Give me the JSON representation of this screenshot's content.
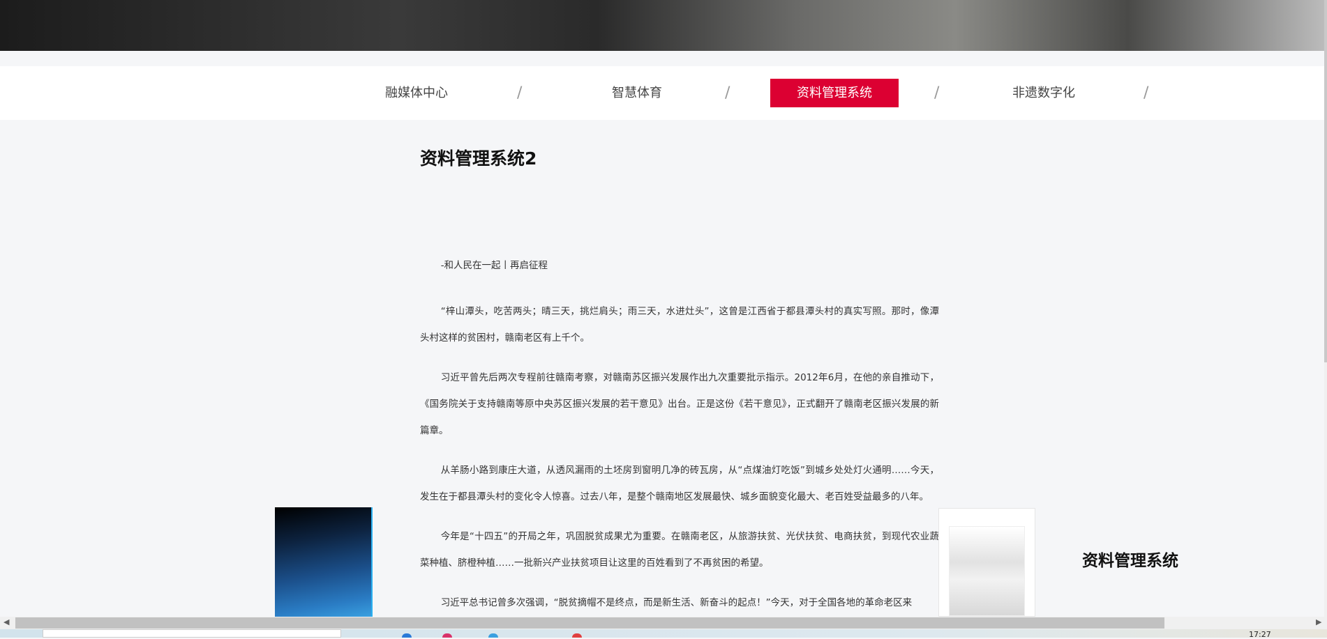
{
  "nav": {
    "items": [
      {
        "label": "融媒体中心",
        "active": false
      },
      {
        "label": "智慧体育",
        "active": false
      },
      {
        "label": "资料管理系统",
        "active": true
      },
      {
        "label": "非遗数字化",
        "active": false
      }
    ],
    "separator": "/"
  },
  "page_title": "资料管理系统2",
  "article": {
    "paragraphs": [
      "-和人民在一起丨再启征程",
      "“梓山潭头，吃苦两头；晴三天，挑烂肩头；雨三天，水进灶头”，这曾是江西省于都县潭头村的真实写照。那时，像潭头村这样的贫困村，赣南老区有上千个。",
      "习近平曾先后两次专程前往赣南考察，对赣南苏区振兴发展作出九次重要批示指示。2012年6月，在他的亲自推动下，《国务院关于支持赣南等原中央苏区振兴发展的若干意见》出台。正是这份《若干意见》，正式翻开了赣南老区振兴发展的新篇章。",
      "从羊肠小路到康庄大道，从透风漏雨的土坯房到窗明几净的砖瓦房，从“点煤油灯吃饭”到城乡处处灯火通明……今天，发生在于都县潭头村的变化令人惊喜。过去八年，是整个赣南地区发展最快、城乡面貌变化最大、老百姓受益最多的八年。",
      "今年是“十四五”的开局之年，巩固脱贫成果尤为重要。在赣南老区，从旅游扶贫、光伏扶贫、电商扶贫，到现代农业蔬菜种植、脐橙种植……一批新兴产业扶贫项目让这里的百姓看到了不再贫困的希望。",
      "习近平总书记曾多次强调，“脱贫摘帽不是终点，而是新生活、新奋斗的起点！”今天，对于全国各地的革命老区来"
    ]
  },
  "side_title": "资料管理系统",
  "taskbar": {
    "time": "17:27"
  },
  "colors": {
    "accent": "#dc0032",
    "background": "#f5f6f8"
  }
}
